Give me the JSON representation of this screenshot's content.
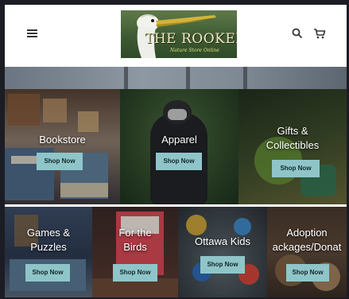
{
  "header": {
    "logo_title": "THE ROOKERY",
    "logo_subtitle": "Nature Store Online",
    "icons": {
      "menu": "hamburger-menu-icon",
      "search": "search-icon",
      "cart": "cart-icon"
    }
  },
  "tiles": [
    {
      "title": "Bookstore",
      "button": "Shop Now"
    },
    {
      "title": "Apparel",
      "button": "Shop Now"
    },
    {
      "title": "Gifts &",
      "title2": "Collectibles",
      "button": "Shop Now"
    },
    {
      "title": "Games &",
      "title2": "Puzzles",
      "button": "Shop Now"
    },
    {
      "title": "For the",
      "title2": "Birds",
      "button": "Shop Now"
    },
    {
      "title": "Ottawa Kids",
      "button": "Shop Now"
    },
    {
      "title": "Adoption",
      "title2": "ackages/Donat",
      "button": "Shop Now"
    }
  ],
  "colors": {
    "button_bg": "#8fc5c9",
    "header_bg": "#ffffff",
    "page_frame": "#1c1c24"
  }
}
